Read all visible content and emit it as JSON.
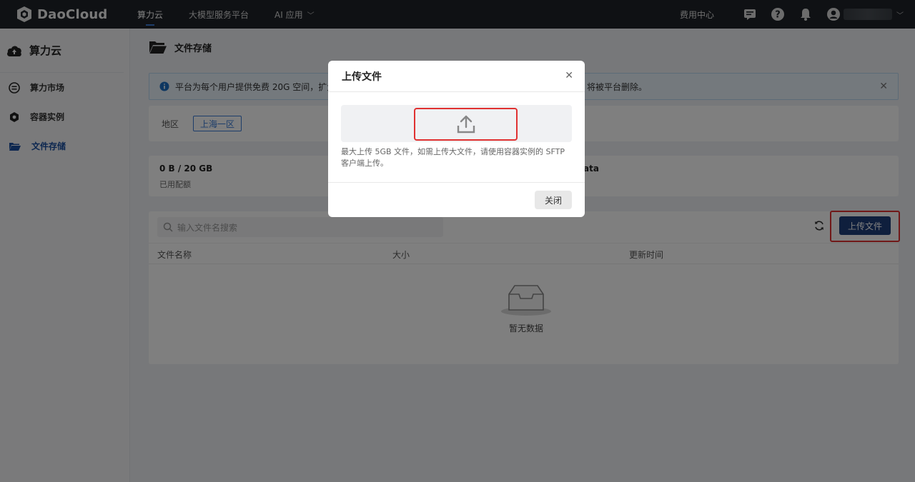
{
  "topbar": {
    "brand": "DaoCloud",
    "nav": [
      {
        "label": "算力云",
        "active": true
      },
      {
        "label": "大模型服务平台",
        "active": false
      },
      {
        "label": "AI 应用",
        "active": false,
        "has_dropdown": true
      }
    ],
    "billing": "费用中心",
    "icons": [
      "message-icon",
      "help-icon",
      "bell-icon",
      "user-avatar-icon"
    ]
  },
  "sidebar": {
    "title": "算力云",
    "items": [
      {
        "label": "算力市场",
        "icon": "market-icon",
        "active": false
      },
      {
        "label": "容器实例",
        "icon": "container-icon",
        "active": false
      },
      {
        "label": "文件存储",
        "icon": "folder-icon",
        "active": true
      }
    ]
  },
  "page": {
    "title": "文件存储",
    "notice_a": "平台为每个用户提供免费 20G 空间，扩大",
    "notice_b": "将被平台删除。",
    "region_label": "地区",
    "region_value": "上海一区",
    "quota_value": "0 B / 20 GB",
    "quota_label": "已用配额",
    "path_fragment": "ata",
    "search_placeholder": "输入文件名搜索",
    "upload_button": "上传文件",
    "columns": [
      "文件名称",
      "大小",
      "更新时间"
    ],
    "empty_text": "暂无数据"
  },
  "modal": {
    "title": "上传文件",
    "hint": "最大上传 5GB 文件，如需上传大文件，请使用容器实例的 SFTP 客户端上传。",
    "close_button": "关闭"
  },
  "colors": {
    "topbar": "#1f2329",
    "accent": "#3a7bd5",
    "primary_button": "#1e3f7a",
    "highlight": "#e03131"
  }
}
